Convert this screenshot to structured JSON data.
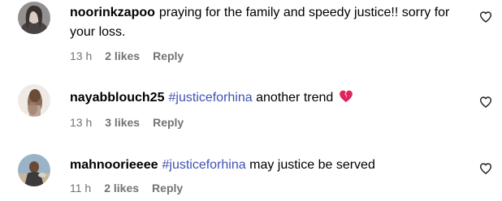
{
  "comments": [
    {
      "username": "noorinkzapoo",
      "text": "praying for the family and speedy justice!! sorry for your loss.",
      "time": "13 h",
      "likes": "2 likes",
      "reply": "Reply"
    },
    {
      "username": "nayabblouch25",
      "hashtag": "#justiceforhina",
      "text": "another trend",
      "emoji": "broken-heart",
      "time": "13 h",
      "likes": "3 likes",
      "reply": "Reply"
    },
    {
      "username": "mahnoorieeee",
      "hashtag": "#justiceforhina",
      "text": "may justice be served",
      "time": "11 h",
      "likes": "2 likes",
      "reply": "Reply"
    }
  ],
  "icons": {
    "like": "heart-outline-icon",
    "emoji": "broken-heart-emoji"
  },
  "colors": {
    "hashtag": "#3f51b5",
    "meta": "#737373",
    "text": "#000000",
    "emoji": "#e0245e"
  }
}
